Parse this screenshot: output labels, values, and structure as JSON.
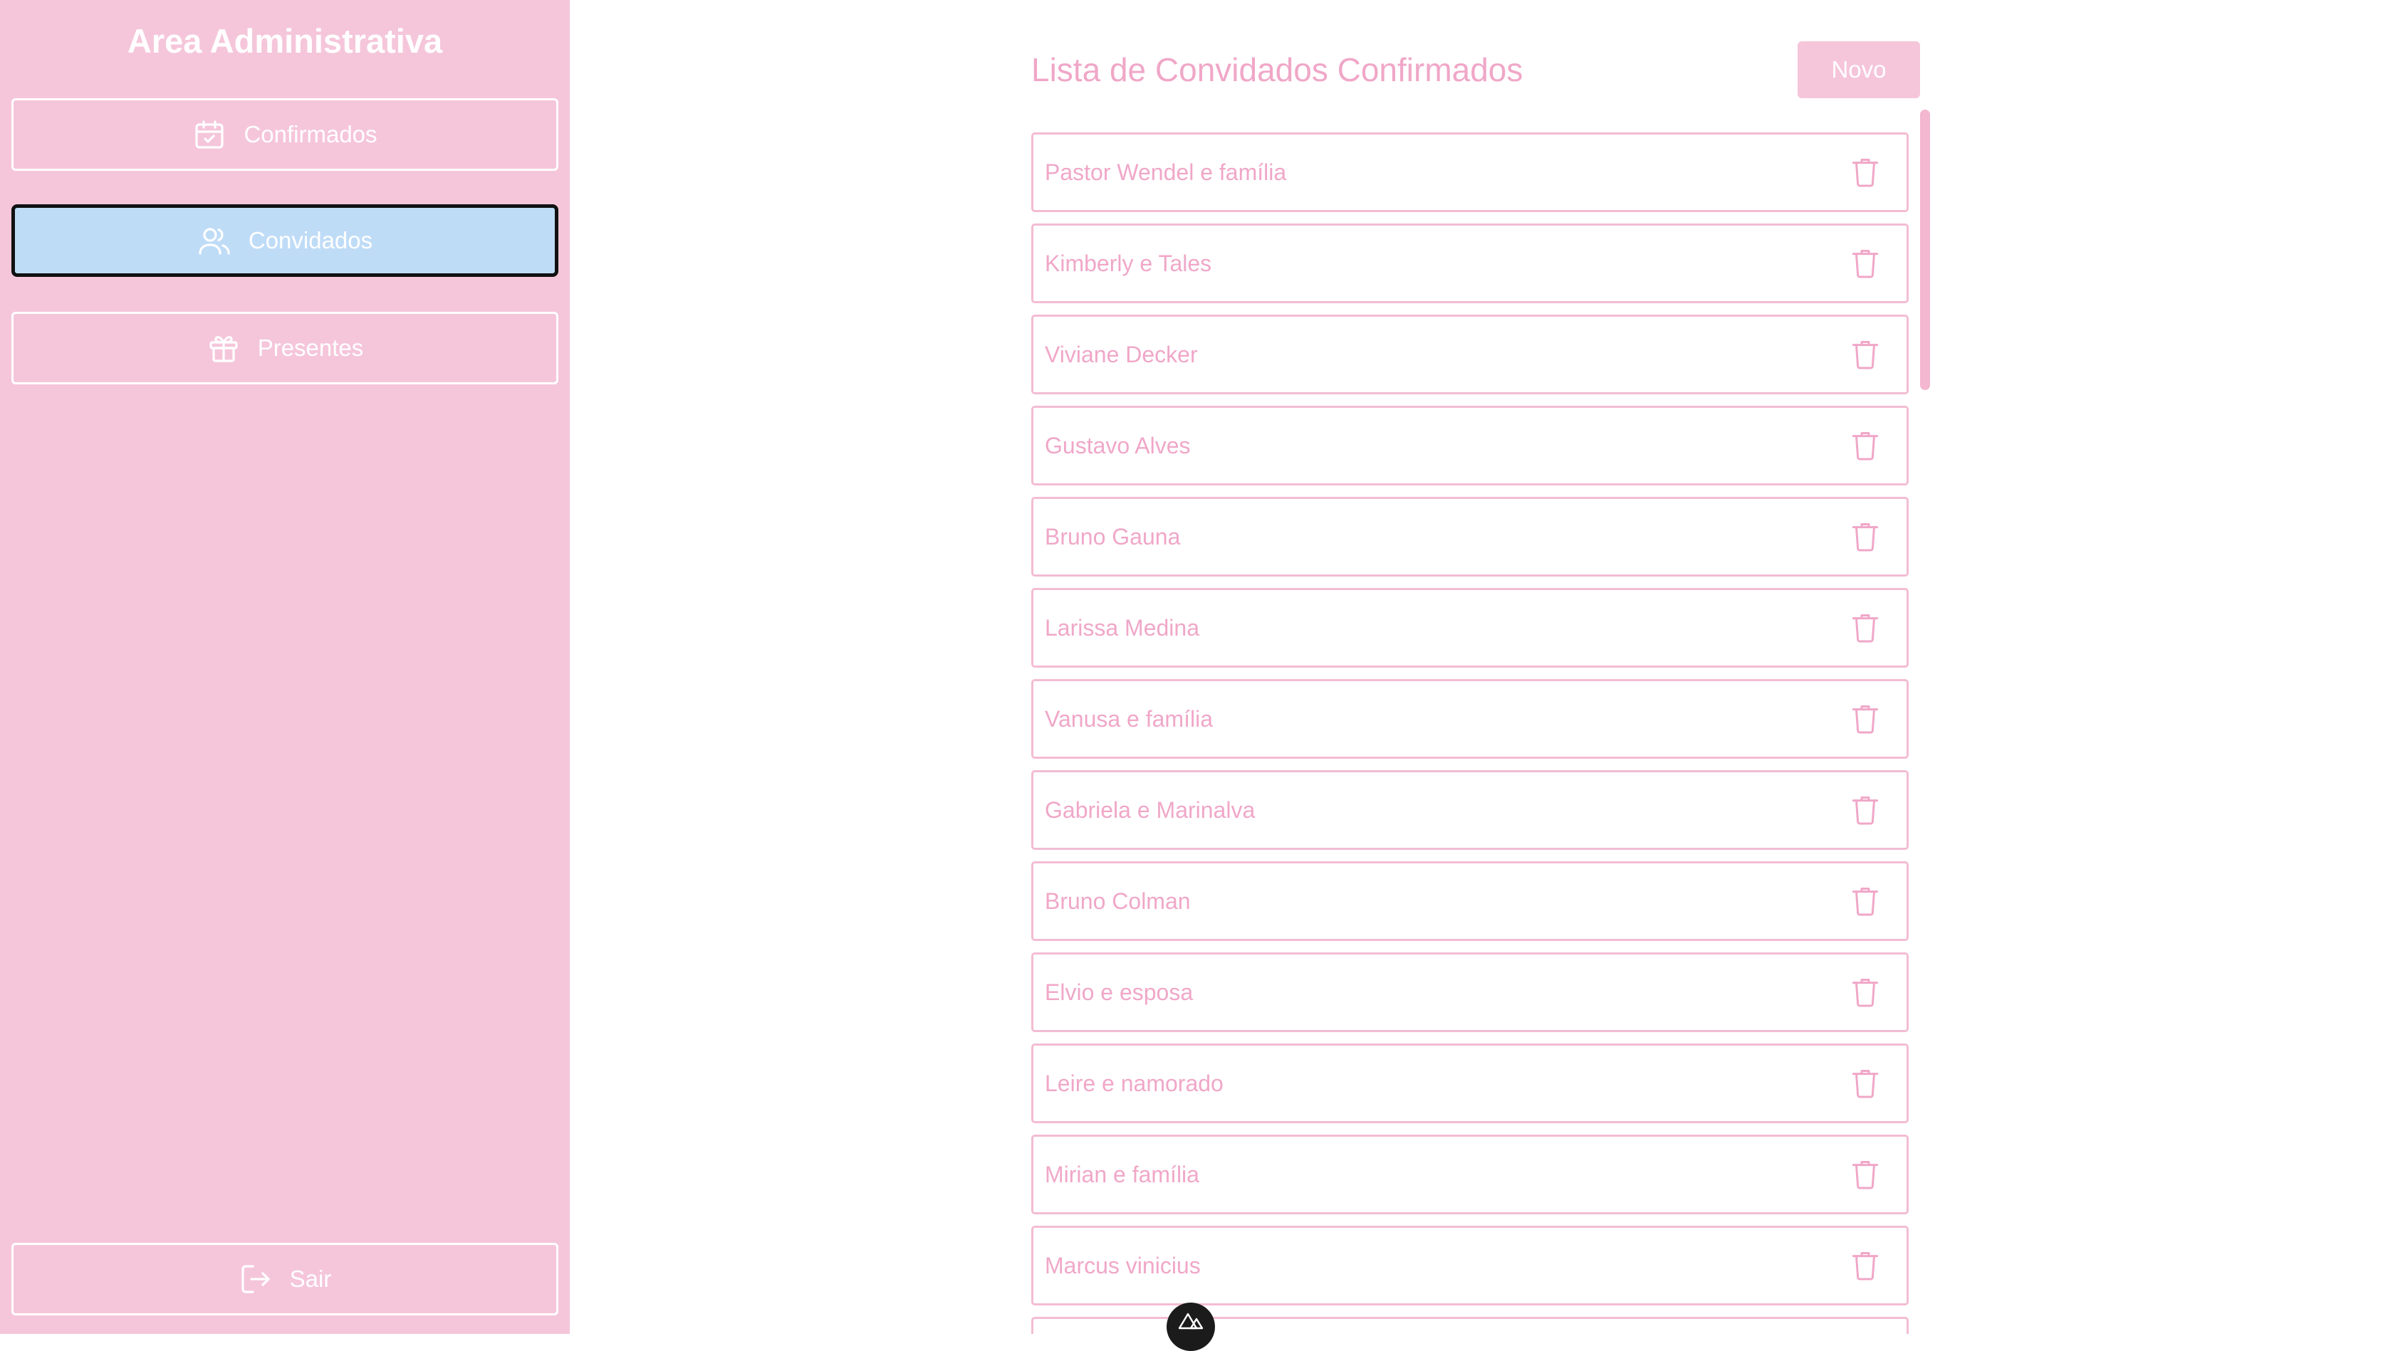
{
  "sidebar": {
    "title": "Area Administrativa",
    "items": [
      {
        "label": "Confirmados",
        "icon": "calendar-check-icon",
        "active": false
      },
      {
        "label": "Convidados",
        "icon": "users-icon",
        "active": true
      },
      {
        "label": "Presentes",
        "icon": "gift-icon",
        "active": false
      }
    ],
    "logout_label": "Sair"
  },
  "main": {
    "title": "Lista de Convidados Confirmados",
    "new_button_label": "Novo",
    "guests": [
      "Pastor Wendel e família",
      "Kimberly e Tales",
      "Viviane Decker",
      "Gustavo Alves",
      "Bruno Gauna",
      "Larissa Medina",
      "Vanusa e família",
      "Gabriela e Marinalva",
      "Bruno Colman",
      "Elvio e esposa",
      "Leire e namorado",
      "Mirian e família",
      "Marcus vinicius",
      ""
    ]
  },
  "colors": {
    "sidebar_bg": "#f5c6da",
    "active_bg": "#bfdcf7",
    "text_pink": "#f0a7c8",
    "border_pink": "#f3bcd3"
  }
}
